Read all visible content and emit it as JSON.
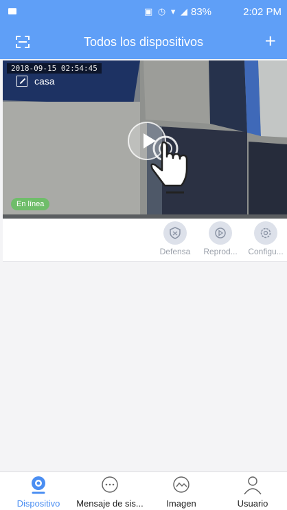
{
  "status_bar": {
    "battery": "83%",
    "time": "2:02 PM"
  },
  "header": {
    "title": "Todos los dispositivos",
    "add_label": "+"
  },
  "device": {
    "timestamp": "2018-09-15 02:54:45",
    "name": "casa",
    "status": "En línea"
  },
  "actions": [
    {
      "label": "Defensa",
      "icon": "shield-icon"
    },
    {
      "label": "Reprod...",
      "icon": "playback-icon"
    },
    {
      "label": "Configu...",
      "icon": "gear-icon"
    }
  ],
  "tabs": [
    {
      "label": "Dispositivo",
      "icon": "camera-icon",
      "active": true
    },
    {
      "label": "Mensaje de sis...",
      "icon": "chat-icon",
      "active": false
    },
    {
      "label": "Imagen",
      "icon": "image-icon",
      "active": false
    },
    {
      "label": "Usuario",
      "icon": "user-icon",
      "active": false
    }
  ],
  "colors": {
    "primary": "#5f9ff7",
    "active_tab": "#4a8ef2",
    "online": "#6fbd6a"
  }
}
